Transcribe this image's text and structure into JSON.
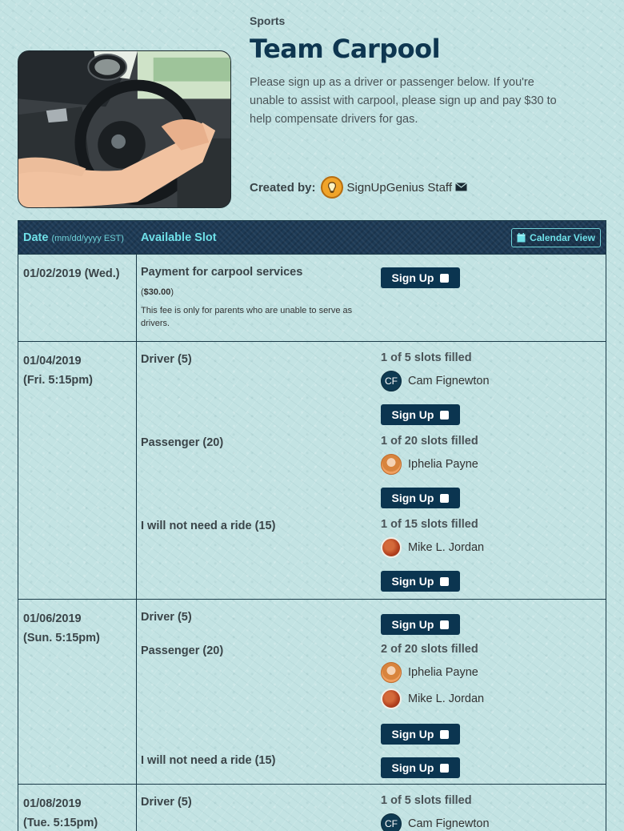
{
  "header": {
    "category": "Sports",
    "title": "Team Carpool",
    "description": "Please sign up as a driver or passenger below. If you're unable to assist with carpool, please sign up and pay $30 to help compensate drivers for gas.",
    "created_by_label": "Created by:",
    "creator_name": "SignUpGenius Staff"
  },
  "table": {
    "date_header": "Date",
    "date_format": "(mm/dd/yyyy EST)",
    "slot_header": "Available Slot",
    "calendar_view": "Calendar View",
    "signup_label": "Sign Up"
  },
  "rows": [
    {
      "date": "01/02/2019 (Wed.)",
      "slots": [
        {
          "name": "Payment for carpool services",
          "price": "$30.00",
          "note": "This fee is only for parents who are unable to serve as drivers."
        }
      ]
    },
    {
      "date_line1": "01/04/2019",
      "date_line2": "(Fri. 5:15pm)",
      "slots": [
        {
          "name": "Driver (5)",
          "filled": "1 of 5 slots filled",
          "people": [
            {
              "initials": "CF",
              "name": "Cam Fignewton"
            }
          ]
        },
        {
          "name": "Passenger (20)",
          "filled": "1 of 20 slots filled",
          "people": [
            {
              "name": "Iphelia Payne"
            }
          ]
        },
        {
          "name": "I will not need a ride (15)",
          "filled": "1 of 15 slots filled",
          "people": [
            {
              "name": "Mike L. Jordan"
            }
          ]
        }
      ]
    },
    {
      "date_line1": "01/06/2019",
      "date_line2": "(Sun. 5:15pm)",
      "slots": [
        {
          "name": "Driver (5)"
        },
        {
          "name": "Passenger (20)",
          "filled": "2 of 20 slots filled",
          "people": [
            {
              "name": "Iphelia Payne"
            },
            {
              "name": "Mike L. Jordan"
            }
          ]
        },
        {
          "name": "I will not need a ride (15)"
        }
      ]
    },
    {
      "date_line1": "01/08/2019",
      "date_line2": "(Tue. 5:15pm)",
      "slots": [
        {
          "name": "Driver (5)",
          "filled": "1 of 5 slots filled",
          "people": [
            {
              "initials": "CF",
              "name": "Cam Fignewton"
            }
          ]
        }
      ]
    }
  ]
}
